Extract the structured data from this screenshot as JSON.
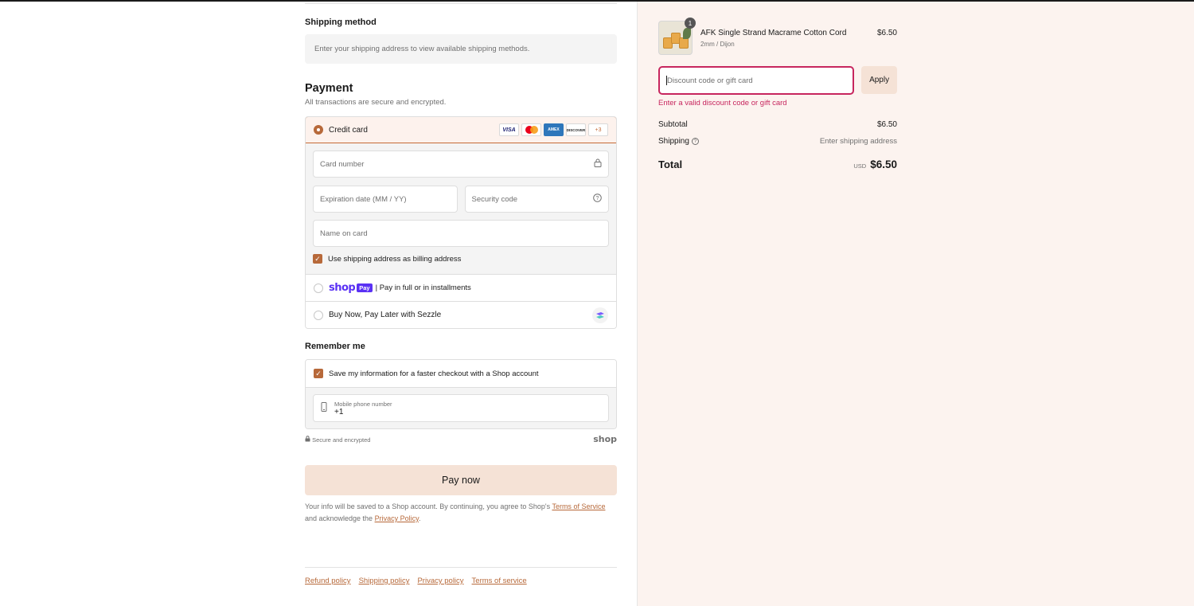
{
  "shipping": {
    "heading": "Shipping method",
    "notice": "Enter your shipping address to view available shipping methods."
  },
  "payment": {
    "heading": "Payment",
    "subheading": "All transactions are secure and encrypted.",
    "credit_card": {
      "label": "Credit card",
      "brands": [
        "VISA",
        "Mastercard",
        "AMEX",
        "DISCOVER"
      ],
      "more": "+3",
      "card_number_placeholder": "Card number",
      "expiration_placeholder": "Expiration date (MM / YY)",
      "security_code_placeholder": "Security code",
      "name_placeholder": "Name on card",
      "billing_same_label": "Use shipping address as billing address",
      "billing_same_checked": true
    },
    "shop_pay": {
      "logo_text": "shop",
      "pay_badge": "Pay",
      "label": "| Pay in full or in installments"
    },
    "sezzle": {
      "label": "Buy Now, Pay Later with Sezzle"
    }
  },
  "remember": {
    "heading": "Remember me",
    "save_label": "Save my information for a faster checkout with a Shop account",
    "save_checked": true,
    "phone_label": "Mobile phone number",
    "phone_value": "+1",
    "secure_text": "Secure and encrypted",
    "shop_mark": "shop"
  },
  "pay_button": "Pay now",
  "legal": {
    "text1": "Your info will be saved to a Shop account. By continuing, you agree to Shop's ",
    "terms_link": "Terms of Service",
    "text2": "and acknowledge the ",
    "privacy_link": "Privacy Policy",
    "text3": "."
  },
  "footer": {
    "links": [
      "Refund policy",
      "Shipping policy",
      "Privacy policy",
      "Terms of service"
    ]
  },
  "summary": {
    "product": {
      "name": "AFK Single Strand Macrame Cotton Cord",
      "variant": "2mm / Dijon",
      "price": "$6.50",
      "quantity": "1"
    },
    "discount_placeholder": "Discount code or gift card",
    "apply_label": "Apply",
    "discount_error": "Enter a valid discount code or gift card",
    "subtotal_label": "Subtotal",
    "subtotal_value": "$6.50",
    "shipping_label": "Shipping",
    "shipping_value": "Enter shipping address",
    "total_label": "Total",
    "currency": "USD",
    "total_value": "$6.50"
  },
  "colors": {
    "accent": "#b7693a",
    "error": "#c7265e",
    "shop_purple": "#5a31f4",
    "summary_bg": "#fcf3ef"
  }
}
